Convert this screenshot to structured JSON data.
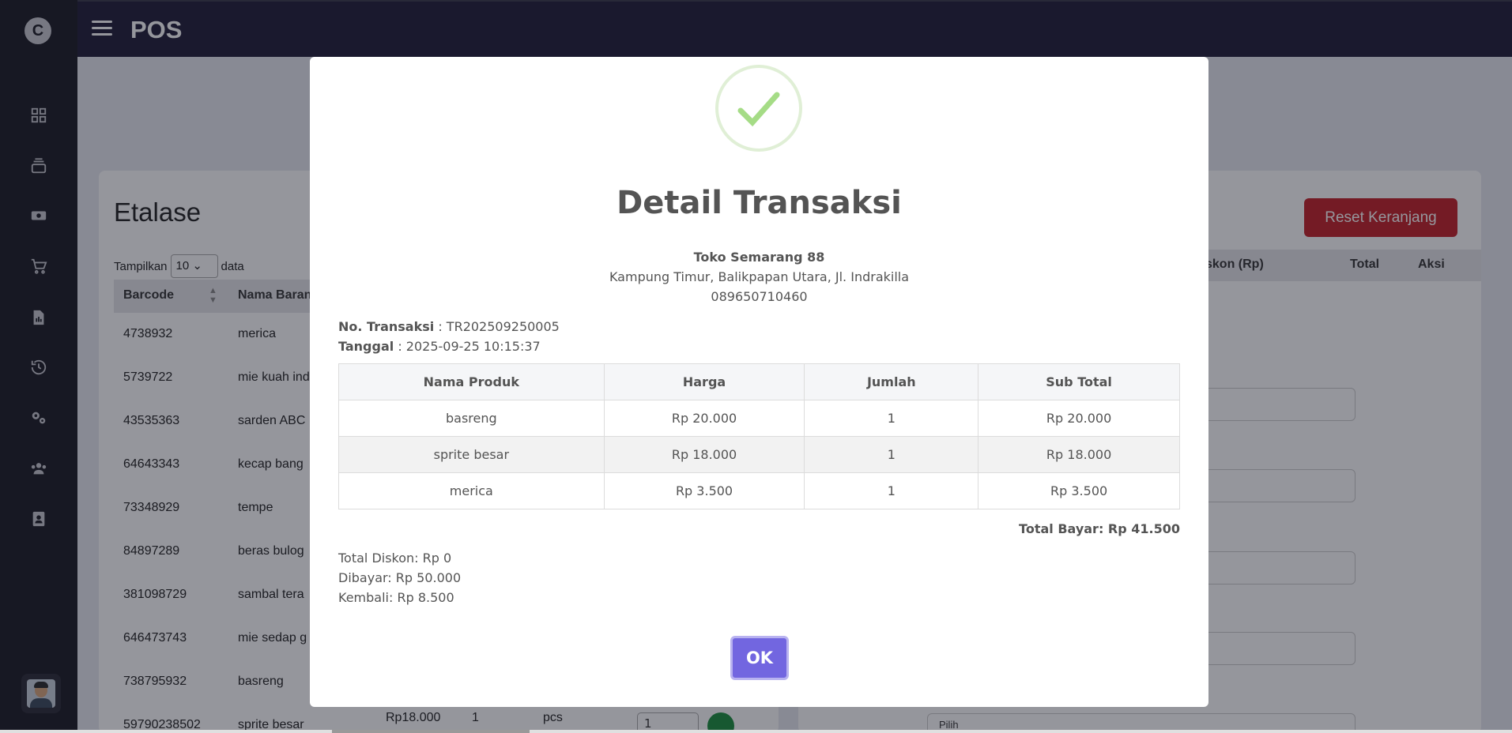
{
  "app": {
    "title": "POS",
    "logo": "C"
  },
  "sidebar": {
    "icons": [
      "dashboard-icon",
      "layers-icon",
      "cash-icon",
      "cart-icon",
      "report-icon",
      "history-icon",
      "settings-icon",
      "users-icon",
      "contact-icon"
    ]
  },
  "background": {
    "etalase_title": "Etalase",
    "show_label": "Tampilkan",
    "show_value": "10",
    "show_suffix": "data",
    "columns": {
      "barcode": "Barcode",
      "name": "Nama Baran"
    },
    "rows": [
      {
        "barcode": "4738932",
        "name": "merica"
      },
      {
        "barcode": "5739722",
        "name": "mie kuah ind"
      },
      {
        "barcode": "43535363",
        "name": "sarden ABC"
      },
      {
        "barcode": "64643343",
        "name": "kecap bang"
      },
      {
        "barcode": "73348929",
        "name": "tempe"
      },
      {
        "barcode": "84897289",
        "name": "beras bulog"
      },
      {
        "barcode": "381098729",
        "name": "sambal tera"
      },
      {
        "barcode": "646473743",
        "name": "mie sedap g"
      },
      {
        "barcode": "738795932",
        "name": "basreng"
      },
      {
        "barcode": "59790238502",
        "name": "sprite besar"
      }
    ],
    "partial_row": {
      "price": "Rp18.000",
      "qty": "1",
      "unit": "pcs",
      "input_value": "1"
    },
    "reset_button": "Reset Keranjang",
    "right_columns": {
      "discount": "skon (Rp)",
      "total": "Total",
      "action": "Aksi"
    },
    "select_placeholder": "Pilih"
  },
  "modal": {
    "title": "Detail Transaksi",
    "store_name": "Toko Semarang 88",
    "store_address": "Kampung Timur, Balikpapan Utara, Jl. Indrakilla",
    "store_phone": "089650710460",
    "trx_label": "No. Transaksi",
    "trx_value": " : TR202509250005",
    "date_label": "Tanggal",
    "date_value": " : 2025-09-25 10:15:37",
    "table_headers": [
      "Nama Produk",
      "Harga",
      "Jumlah",
      "Sub Total"
    ],
    "items": [
      {
        "name": "basreng",
        "price": "Rp 20.000",
        "qty": "1",
        "subtotal": "Rp 20.000"
      },
      {
        "name": "sprite besar",
        "price": "Rp 18.000",
        "qty": "1",
        "subtotal": "Rp 18.000"
      },
      {
        "name": "merica",
        "price": "Rp 3.500",
        "qty": "1",
        "subtotal": "Rp 3.500"
      }
    ],
    "total_bayar": "Total Bayar: Rp 41.500",
    "total_diskon": "Total Diskon: Rp 0",
    "dibayar": "Dibayar: Rp 50.000",
    "kembali": "Kembali: Rp 8.500",
    "ok_label": "OK"
  },
  "colors": {
    "accent": "#7266e0",
    "danger": "#c42027",
    "success": "#a5dc86",
    "sidebar": "#1a1a24",
    "topbar": "#1f1d38"
  }
}
